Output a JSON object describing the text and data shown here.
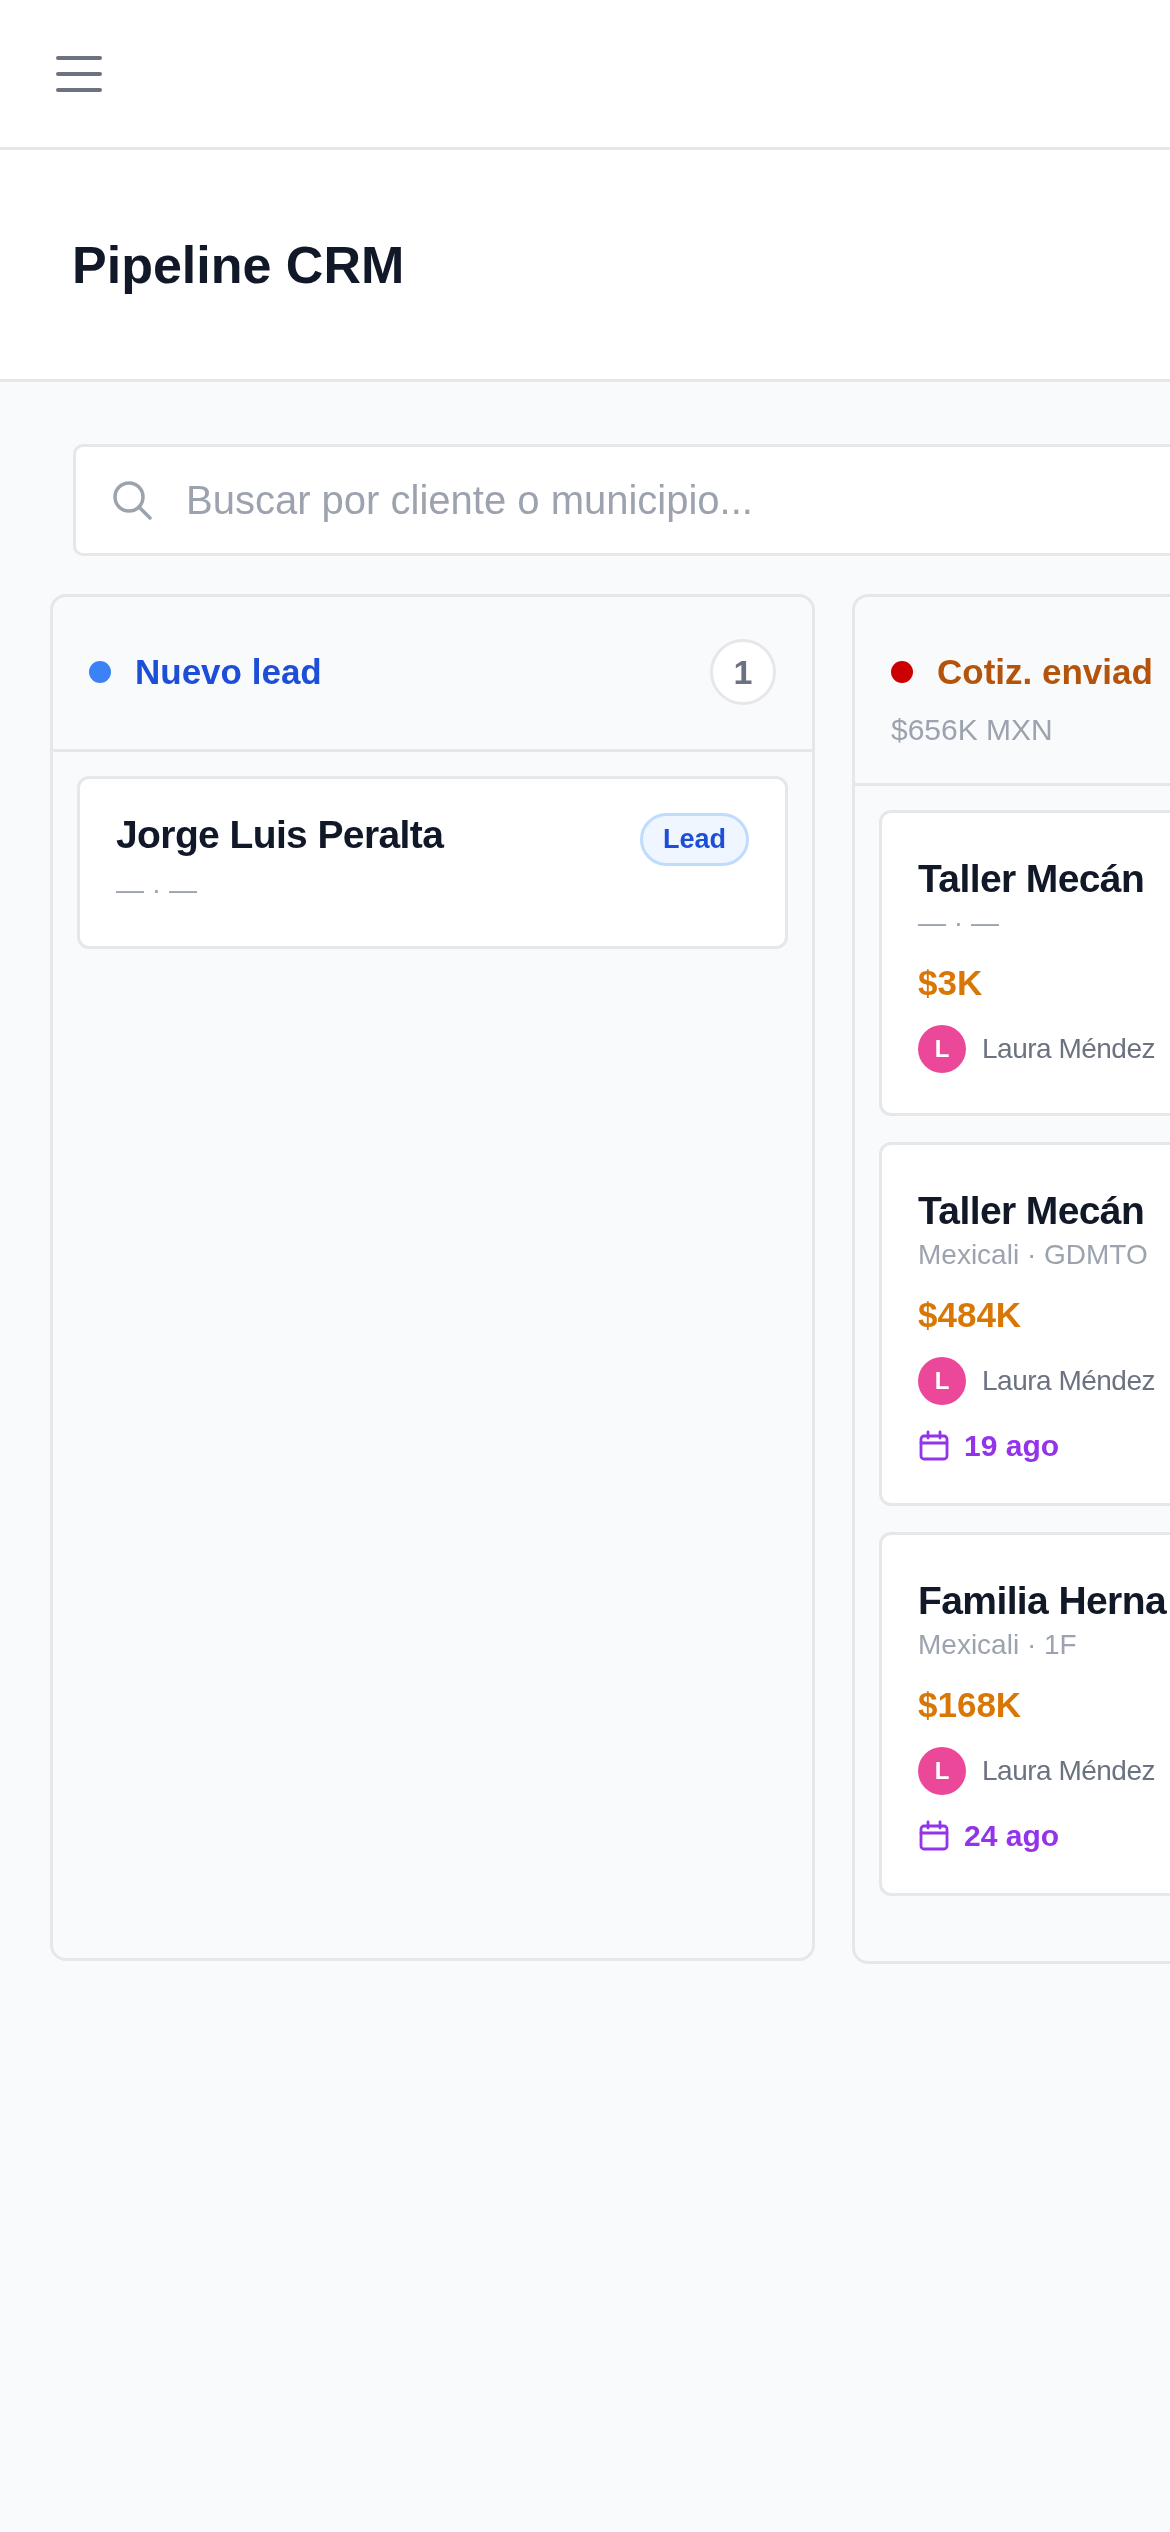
{
  "page_title": "Pipeline CRM",
  "search": {
    "placeholder": "Buscar por cliente o municipio..."
  },
  "columns": [
    {
      "title": "Nuevo lead",
      "color": "#3b82f6",
      "count": "1",
      "cards": [
        {
          "name": "Jorge Luis Peralta",
          "subtitle": "— · —",
          "badge": "Lead"
        }
      ]
    },
    {
      "title": "Cotiz. enviad",
      "color": "#cc0000",
      "total": "$656K MXN",
      "cards": [
        {
          "name": "Taller Mecán",
          "subtitle": "— · —",
          "amount": "$3K",
          "owner": {
            "initial": "L",
            "name": "Laura Méndez"
          }
        },
        {
          "name": "Taller Mecán",
          "subtitle": "Mexicali · GDMTO",
          "amount": "$484K",
          "owner": {
            "initial": "L",
            "name": "Laura Méndez"
          },
          "date": "19 ago"
        },
        {
          "name": "Familia Herna",
          "subtitle": "Mexicali · 1F",
          "amount": "$168K",
          "owner": {
            "initial": "L",
            "name": "Laura Méndez"
          },
          "date": "24 ago"
        }
      ]
    }
  ]
}
